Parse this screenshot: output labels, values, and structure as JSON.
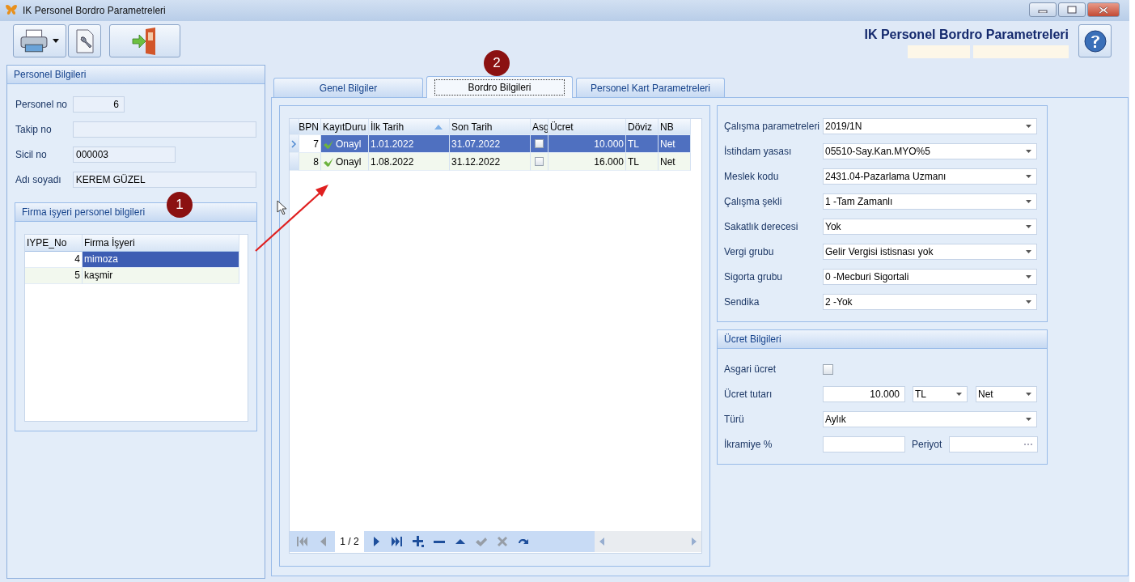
{
  "window": {
    "title": "IK Personel Bordro Parametreleri"
  },
  "header": {
    "title": "IK Personel Bordro Parametreleri"
  },
  "personnel": {
    "title": "Personel Bilgileri",
    "fields": [
      {
        "label": "Personel no",
        "value": "6"
      },
      {
        "label": "Takip no"
      },
      {
        "label": "Sicil no",
        "value": "000003"
      },
      {
        "label": "Adı soyadı",
        "value": "KEREM GÜZEL"
      }
    ]
  },
  "firm": {
    "title": "Firma işyeri personel bilgileri",
    "columns": [
      "IYPE_No",
      "Firma İşyeri"
    ],
    "rows": [
      {
        "no": "4",
        "name": "mimoza",
        "selected": true
      },
      {
        "no": "5",
        "name": "kaşmir",
        "selected": false
      }
    ]
  },
  "tabs": [
    {
      "label": "Genel Bilgiler",
      "selected": false
    },
    {
      "label": "Bordro Bilgileri",
      "selected": true
    },
    {
      "label": "Personel Kart Parametreleri",
      "selected": false
    }
  ],
  "payroll": {
    "columns": [
      {
        "label": "BPN"
      },
      {
        "label": "KayıtDuru"
      },
      {
        "label": "İlk Tarih",
        "sorted": true
      },
      {
        "label": "Son Tarih"
      },
      {
        "label": "Asg"
      },
      {
        "label": "Ücret"
      },
      {
        "label": "Döviz"
      },
      {
        "label": "NB"
      }
    ],
    "rows": [
      {
        "bpn": "7",
        "status": "Onayl",
        "start": "1.01.2022",
        "end": "31.07.2022",
        "min_wage": false,
        "wage": "10.000",
        "currency": "TL",
        "type": "Net",
        "selected": true
      },
      {
        "bpn": "8",
        "status": "Onayl",
        "start": "1.08.2022",
        "end": "31.12.2022",
        "min_wage": false,
        "wage": "16.000",
        "currency": "TL",
        "type": "Net",
        "selected": false
      }
    ]
  },
  "navigator": {
    "page": "1 / 2",
    "buttons": [
      {
        "kind": "first",
        "disabled": true
      },
      {
        "kind": "prev",
        "disabled": true
      },
      {
        "kind": "next",
        "disabled": false
      },
      {
        "kind": "last",
        "disabled": false
      },
      {
        "kind": "add",
        "disabled": false
      },
      {
        "kind": "remove",
        "disabled": false
      },
      {
        "kind": "up",
        "disabled": false
      },
      {
        "kind": "apply",
        "disabled": true
      },
      {
        "kind": "cancel",
        "disabled": true
      },
      {
        "kind": "refresh",
        "disabled": false
      }
    ]
  },
  "parameters": [
    {
      "label": "Çalışma parametreleri",
      "value": "2019/1N"
    },
    {
      "label": "İstihdam yasası",
      "value": "05510-Say.Kan.MYO%5"
    },
    {
      "label": "Meslek kodu",
      "value": "2431.04-Pazarlama Uzmanı"
    },
    {
      "label": "Çalışma şekli",
      "value": "1 -Tam Zamanlı"
    },
    {
      "label": "Sakatlık derecesi",
      "value": "Yok"
    },
    {
      "label": "Vergi grubu",
      "value": "Gelir Vergisi istisnası yok"
    },
    {
      "label": "Sigorta grubu",
      "value": "0 -Mecburi Sigortali"
    },
    {
      "label": "Sendika",
      "value": "2 -Yok"
    }
  ],
  "wage": {
    "title": "Ücret Bilgileri",
    "min_wage": {
      "label": "Asgari ücret",
      "checked": false
    },
    "amount": {
      "label": "Ücret tutarı",
      "value": "10.000",
      "currency": "TL",
      "type": "Net"
    },
    "period_type": {
      "label": "Türü",
      "value": "Aylık"
    },
    "bonus": {
      "label": "İkramiye %",
      "period_label": "Periyot"
    }
  },
  "annotations": [
    {
      "label": "1"
    },
    {
      "label": "2"
    }
  ]
}
